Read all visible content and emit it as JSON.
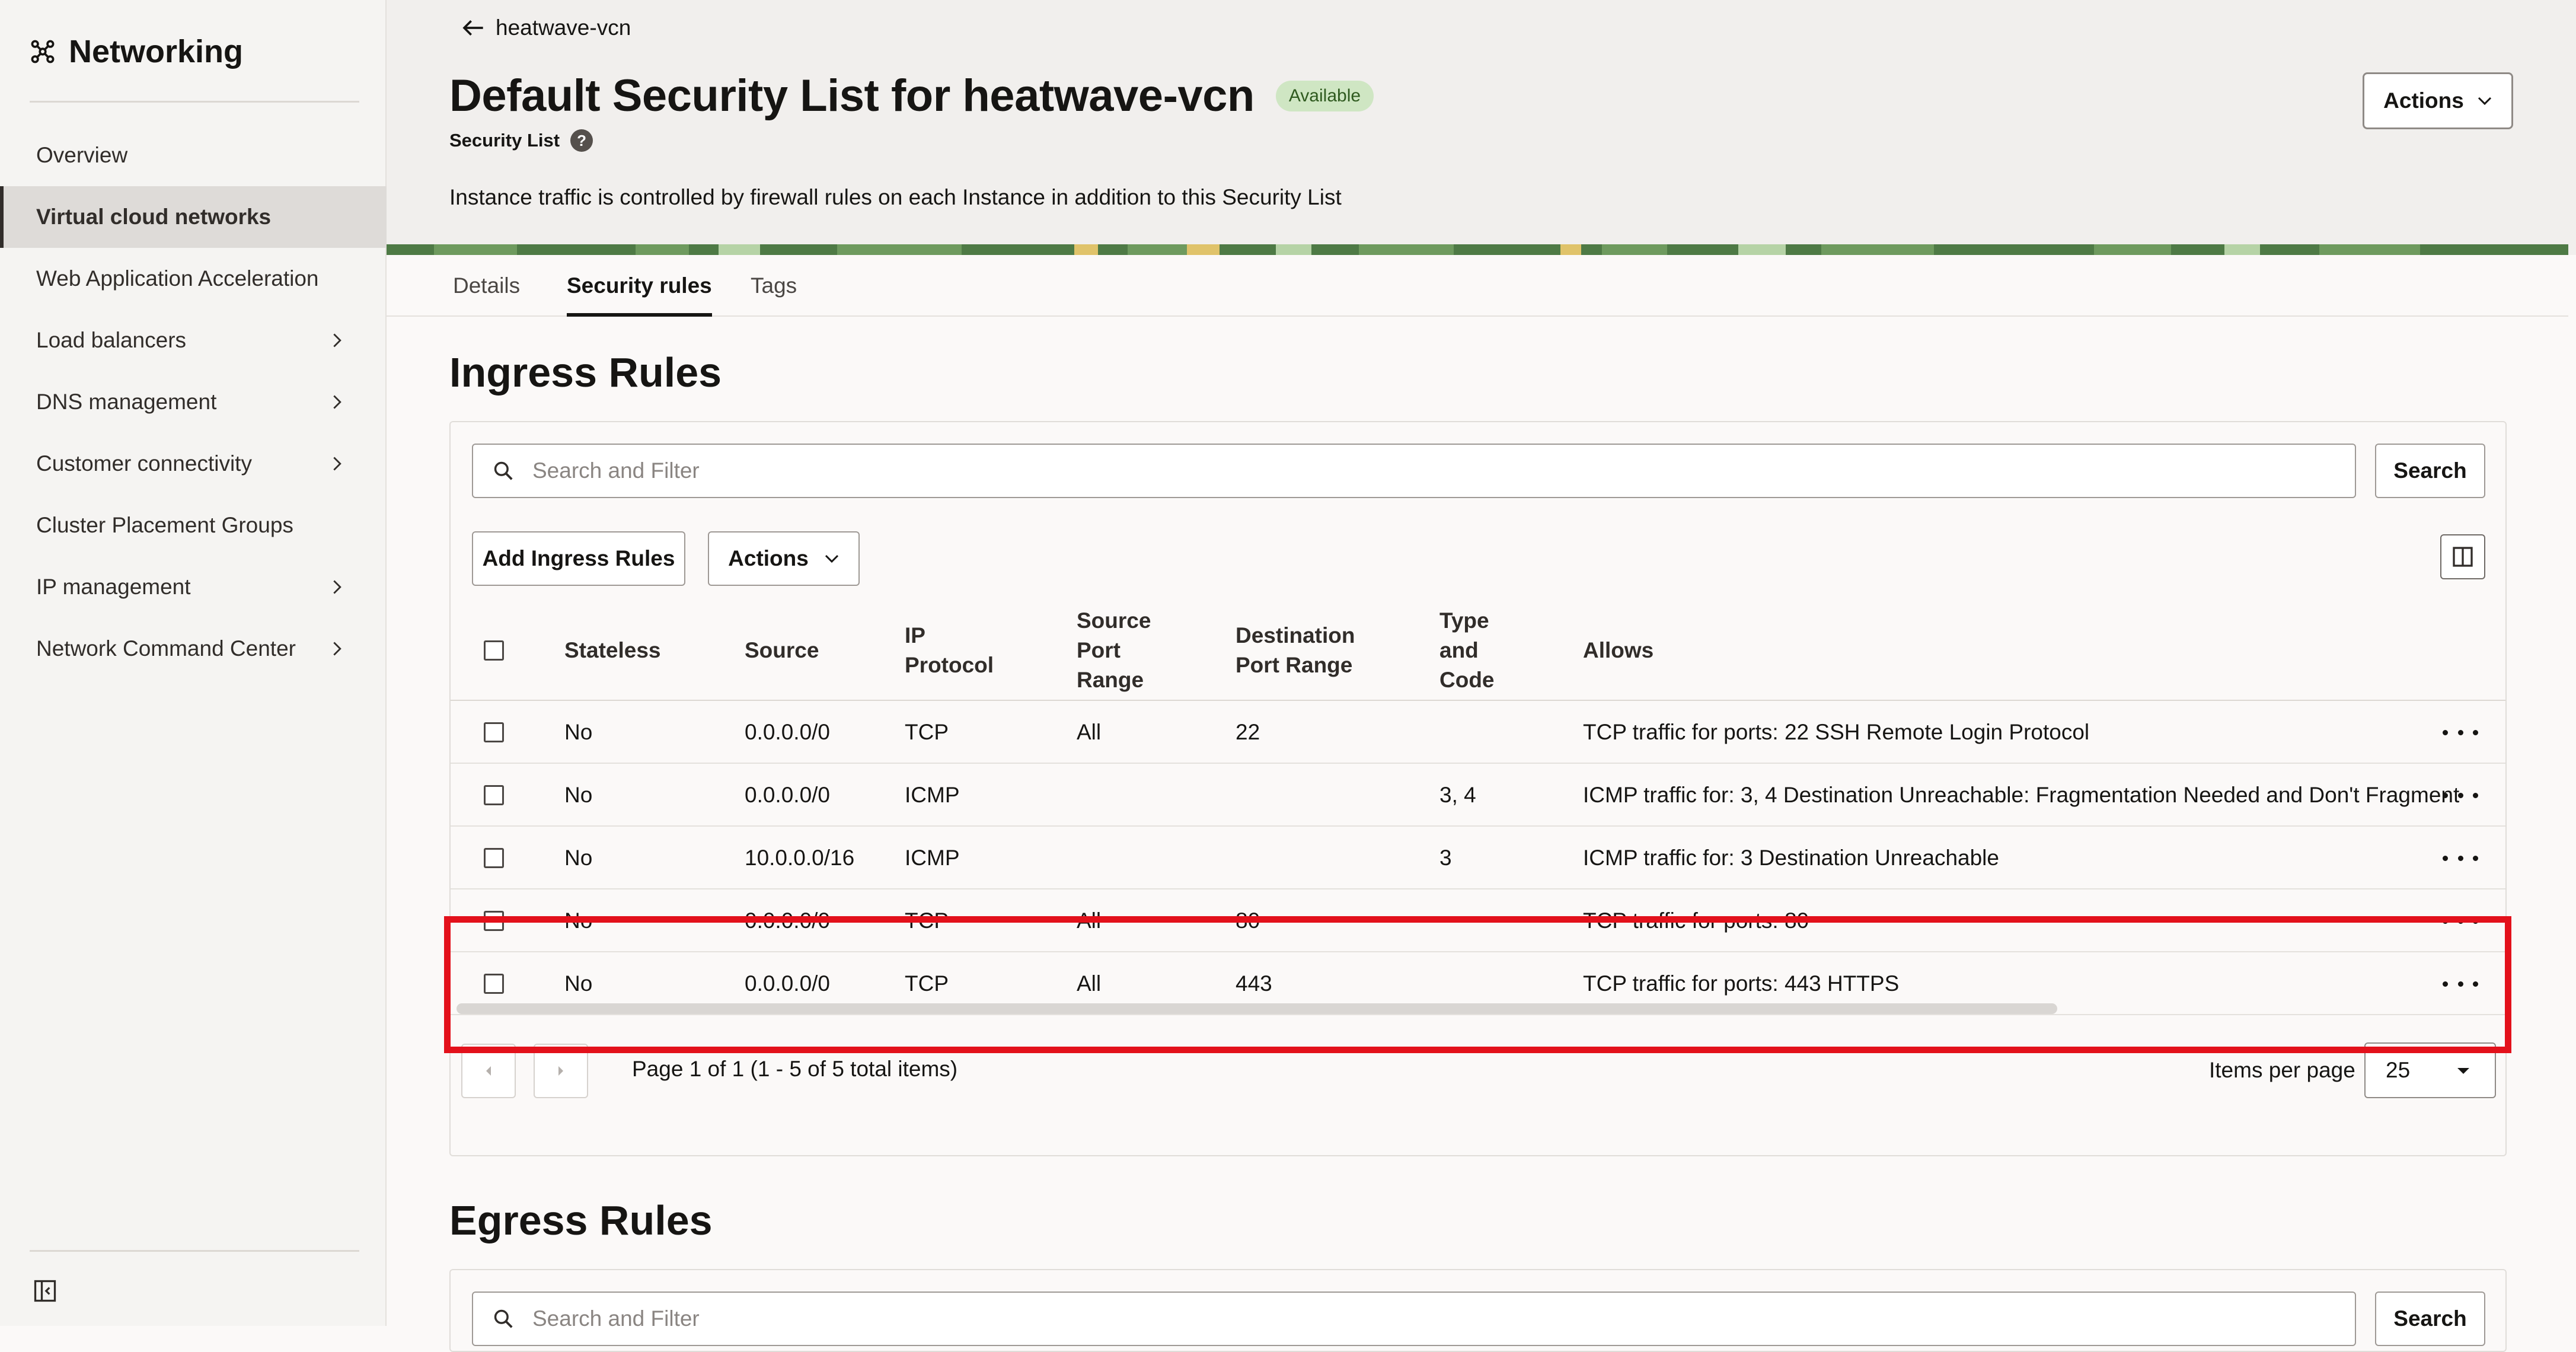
{
  "sidebar": {
    "app_title": "Networking",
    "items": [
      {
        "label": "Overview",
        "has_submenu": false,
        "active": false
      },
      {
        "label": "Virtual cloud networks",
        "has_submenu": false,
        "active": true
      },
      {
        "label": "Web Application Acceleration",
        "has_submenu": false,
        "active": false
      },
      {
        "label": "Load balancers",
        "has_submenu": true,
        "active": false
      },
      {
        "label": "DNS management",
        "has_submenu": true,
        "active": false
      },
      {
        "label": "Customer connectivity",
        "has_submenu": true,
        "active": false
      },
      {
        "label": "Cluster Placement Groups",
        "has_submenu": false,
        "active": false
      },
      {
        "label": "IP management",
        "has_submenu": true,
        "active": false
      },
      {
        "label": "Network Command Center",
        "has_submenu": true,
        "active": false
      }
    ]
  },
  "header": {
    "back_link": "heatwave-vcn",
    "title": "Default Security List for heatwave-vcn",
    "status": "Available",
    "subtitle": "Security List",
    "description": "Instance traffic is controlled by firewall rules on each Instance in addition to this Security List",
    "actions_label": "Actions"
  },
  "tabs": [
    {
      "label": "Details",
      "active": false
    },
    {
      "label": "Security rules",
      "active": true
    },
    {
      "label": "Tags",
      "active": false
    }
  ],
  "ingress": {
    "title": "Ingress Rules",
    "search_placeholder": "Search and Filter",
    "search_button": "Search",
    "add_button": "Add Ingress Rules",
    "actions_button": "Actions",
    "columns": [
      "Stateless",
      "Source",
      "IP\nProtocol",
      "Source\nPort\nRange",
      "Destination\nPort Range",
      "Type\nand\nCode",
      "Allows"
    ],
    "rows": [
      {
        "stateless": "No",
        "source": "0.0.0.0/0",
        "protocol": "TCP",
        "source_port": "All",
        "dest_port": "22",
        "type_code": "",
        "allows": "TCP traffic for ports: 22 SSH Remote Login Protocol"
      },
      {
        "stateless": "No",
        "source": "0.0.0.0/0",
        "protocol": "ICMP",
        "source_port": "",
        "dest_port": "",
        "type_code": "3, 4",
        "allows": "ICMP traffic for: 3, 4 Destination Unreachable: Fragmentation Needed and Don't Fragment"
      },
      {
        "stateless": "No",
        "source": "10.0.0.0/16",
        "protocol": "ICMP",
        "source_port": "",
        "dest_port": "",
        "type_code": "3",
        "allows": "ICMP traffic for: 3 Destination Unreachable"
      },
      {
        "stateless": "No",
        "source": "0.0.0.0/0",
        "protocol": "TCP",
        "source_port": "All",
        "dest_port": "80",
        "type_code": "",
        "allows": "TCP traffic for ports: 80"
      },
      {
        "stateless": "No",
        "source": "0.0.0.0/0",
        "protocol": "TCP",
        "source_port": "All",
        "dest_port": "443",
        "type_code": "",
        "allows": "TCP traffic for ports: 443 HTTPS"
      }
    ],
    "pagination": {
      "page_info": "Page 1 of 1 (1 - 5 of 5 total items)",
      "items_per_page_label": "Items per page",
      "items_per_page": "25"
    }
  },
  "egress": {
    "title": "Egress Rules",
    "search_placeholder": "Search and Filter",
    "search_button": "Search"
  },
  "colors": {
    "highlight": "#e3111b",
    "badge_bg": "#cfe6c3",
    "active_nav_bg": "#dedbd8"
  }
}
